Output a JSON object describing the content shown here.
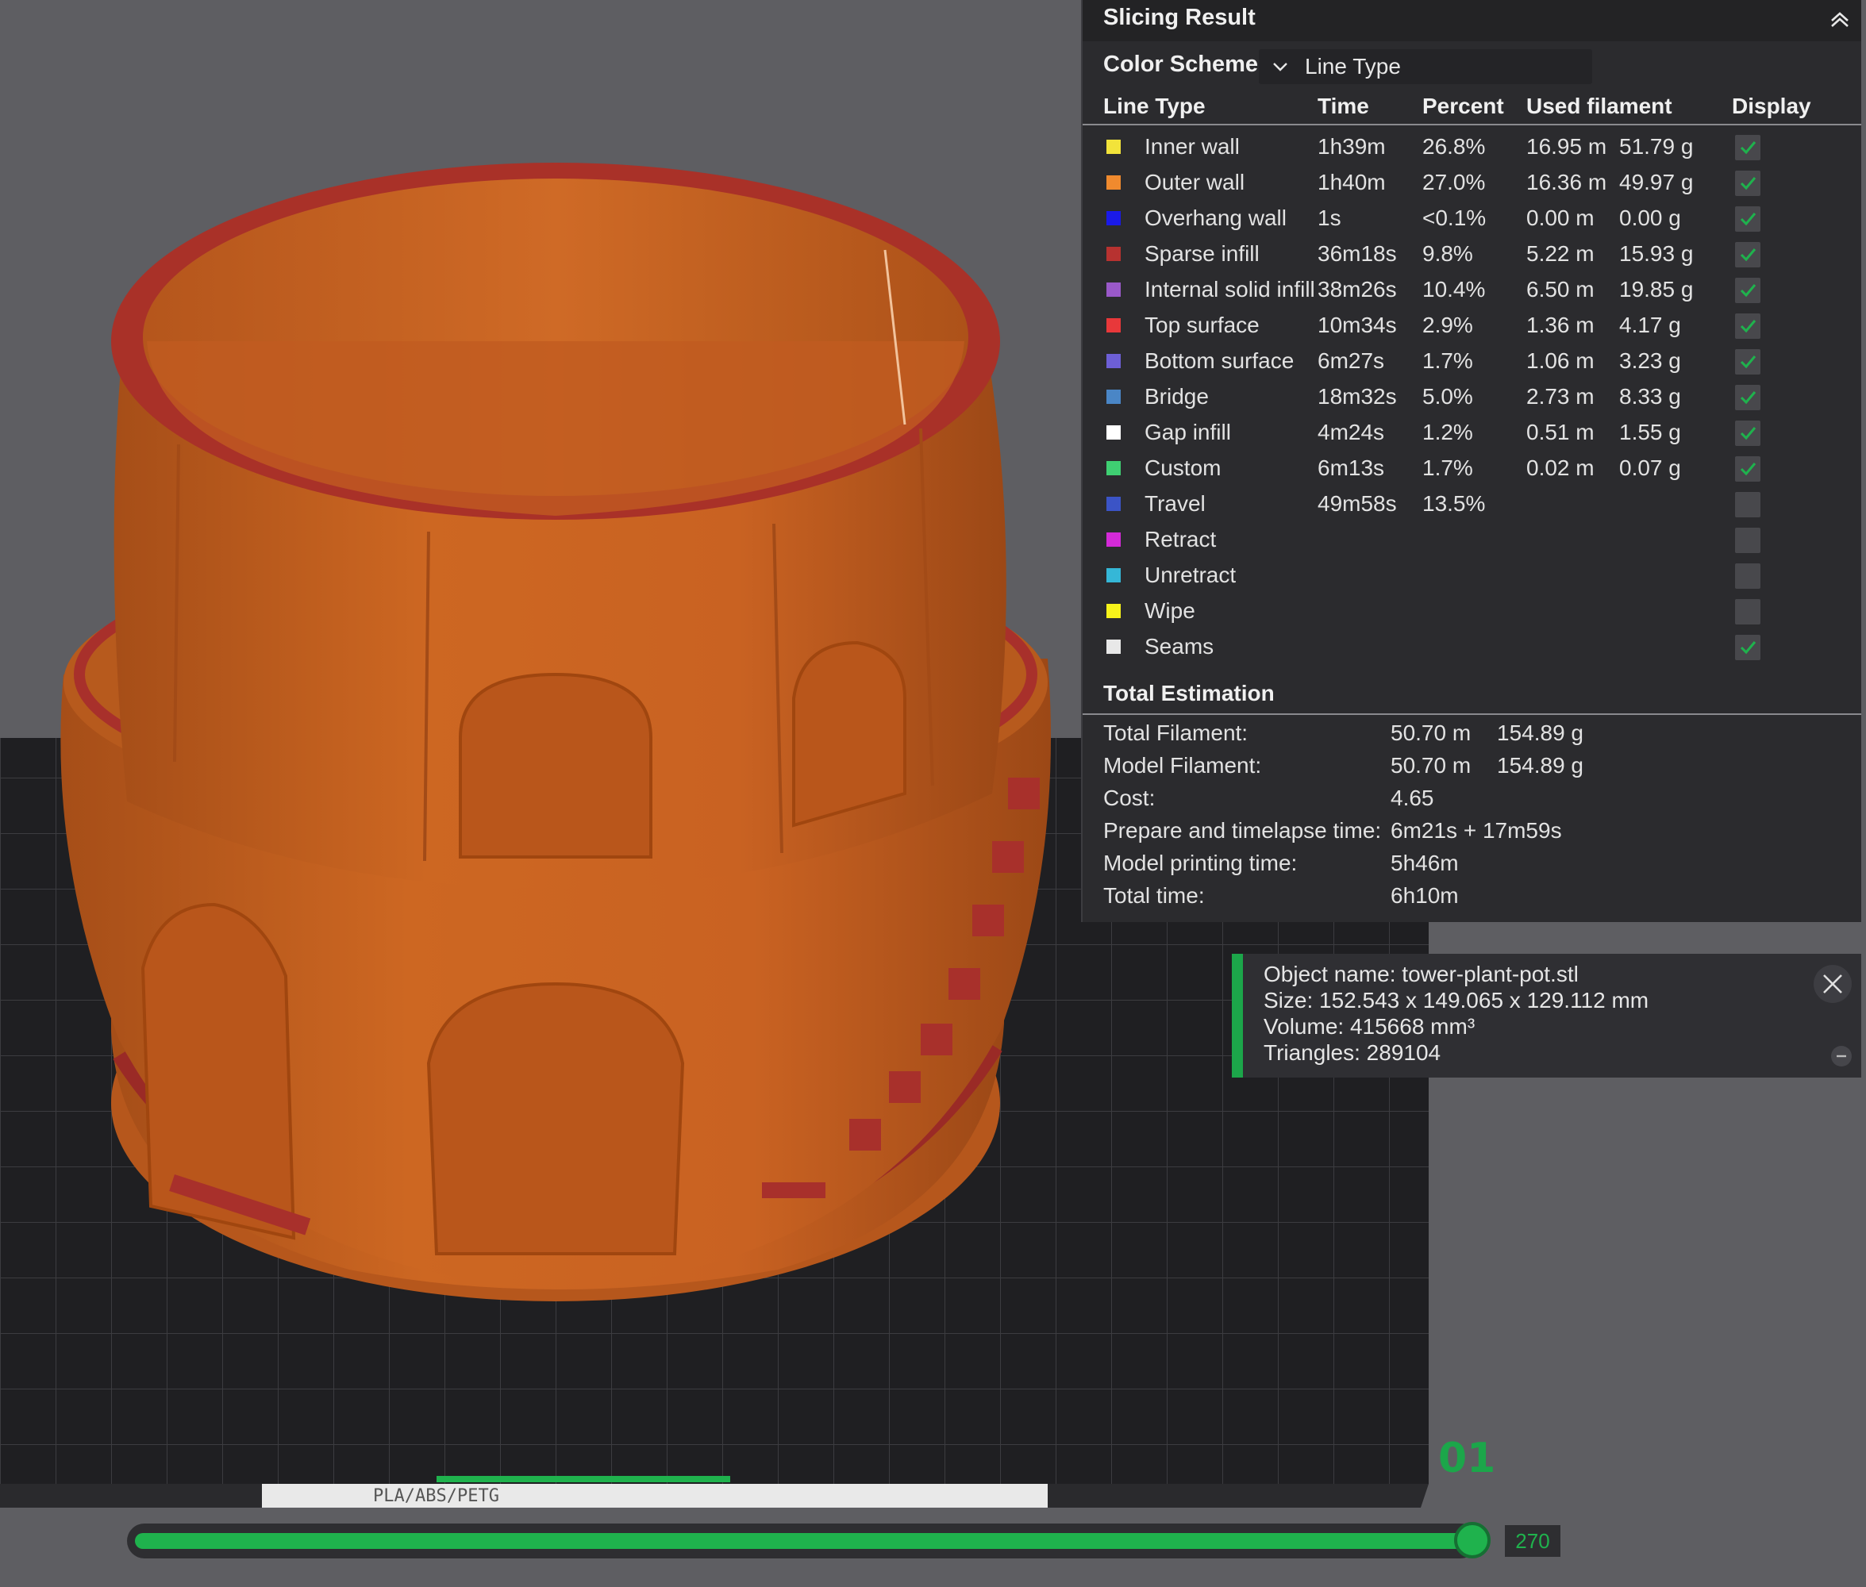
{
  "panel": {
    "title": "Slicing Result",
    "color_scheme_label": "Color Scheme",
    "color_scheme_value": "Line Type"
  },
  "table": {
    "headers": [
      "Line Type",
      "Time",
      "Percent",
      "Used filament",
      "Display"
    ],
    "rows": [
      {
        "name": "Inner wall",
        "color": "#f2e33a",
        "time": "1h39m",
        "percent": "26.8%",
        "length": "16.95 m",
        "weight": "51.79 g",
        "display": "checked"
      },
      {
        "name": "Outer wall",
        "color": "#f08a2e",
        "time": "1h40m",
        "percent": "27.0%",
        "length": "16.36 m",
        "weight": "49.97 g",
        "display": "checked"
      },
      {
        "name": "Overhang wall",
        "color": "#1a1ae8",
        "time": "1s",
        "percent": "<0.1%",
        "length": "0.00 m",
        "weight": "0.00 g",
        "display": "checked"
      },
      {
        "name": "Sparse infill",
        "color": "#b73230",
        "time": "36m18s",
        "percent": "9.8%",
        "length": "5.22 m",
        "weight": "15.93 g",
        "display": "checked"
      },
      {
        "name": "Internal solid infill",
        "color": "#9a59c9",
        "time": "38m26s",
        "percent": "10.4%",
        "length": "6.50 m",
        "weight": "19.85 g",
        "display": "checked"
      },
      {
        "name": "Top surface",
        "color": "#e8383a",
        "time": "10m34s",
        "percent": "2.9%",
        "length": "1.36 m",
        "weight": "4.17 g",
        "display": "checked"
      },
      {
        "name": "Bottom surface",
        "color": "#6d5fd6",
        "time": "6m27s",
        "percent": "1.7%",
        "length": "1.06 m",
        "weight": "3.23 g",
        "display": "checked"
      },
      {
        "name": "Bridge",
        "color": "#4a86c6",
        "time": "18m32s",
        "percent": "5.0%",
        "length": "2.73 m",
        "weight": "8.33 g",
        "display": "checked"
      },
      {
        "name": "Gap infill",
        "color": "#ffffff",
        "time": "4m24s",
        "percent": "1.2%",
        "length": "0.51 m",
        "weight": "1.55 g",
        "display": "checked"
      },
      {
        "name": "Custom",
        "color": "#3fcf72",
        "time": "6m13s",
        "percent": "1.7%",
        "length": "0.02 m",
        "weight": "0.07 g",
        "display": "checked"
      },
      {
        "name": "Travel",
        "color": "#3b54c6",
        "time": "49m58s",
        "percent": "13.5%",
        "length": "",
        "weight": "",
        "display": "unchecked"
      },
      {
        "name": "Retract",
        "color": "#d42ad8",
        "time": "",
        "percent": "",
        "length": "",
        "weight": "",
        "display": "unchecked"
      },
      {
        "name": "Unretract",
        "color": "#35b7d7",
        "time": "",
        "percent": "",
        "length": "",
        "weight": "",
        "display": "unchecked"
      },
      {
        "name": "Wipe",
        "color": "#f7f31a",
        "time": "",
        "percent": "",
        "length": "",
        "weight": "",
        "display": "unchecked"
      },
      {
        "name": "Seams",
        "color": "#e8e8e8",
        "time": "",
        "percent": "",
        "length": "",
        "weight": "",
        "display": "checked"
      }
    ]
  },
  "estimation": {
    "title": "Total Estimation",
    "rows": [
      {
        "label": "Total Filament:",
        "v1": "50.70 m",
        "v2": "154.89 g"
      },
      {
        "label": "Model Filament:",
        "v1": "50.70 m",
        "v2": "154.89 g"
      },
      {
        "label": "Cost:",
        "v1": "4.65",
        "v2": ""
      },
      {
        "label": "Prepare and timelapse time:",
        "v1": "6m21s + 17m59s",
        "v2": ""
      },
      {
        "label": "Model printing time:",
        "v1": "5h46m",
        "v2": ""
      },
      {
        "label": "Total time:",
        "v1": "6h10m",
        "v2": ""
      }
    ]
  },
  "object_info": {
    "name_line": "Object name: tower-plant-pot.stl",
    "size_line": "Size: 152.543 x 149.065 x 129.112 mm",
    "volume_line": "Volume: 415668 mm³",
    "triangles_line": "Triangles: 289104"
  },
  "viewport": {
    "plate_number": "01",
    "plate_label": "PLA/ABS/PETG",
    "model_color": "#c8601f",
    "accent_color": "#1fb24d"
  },
  "layer_slider": {
    "value": "270",
    "fill_fraction": 1.0
  }
}
